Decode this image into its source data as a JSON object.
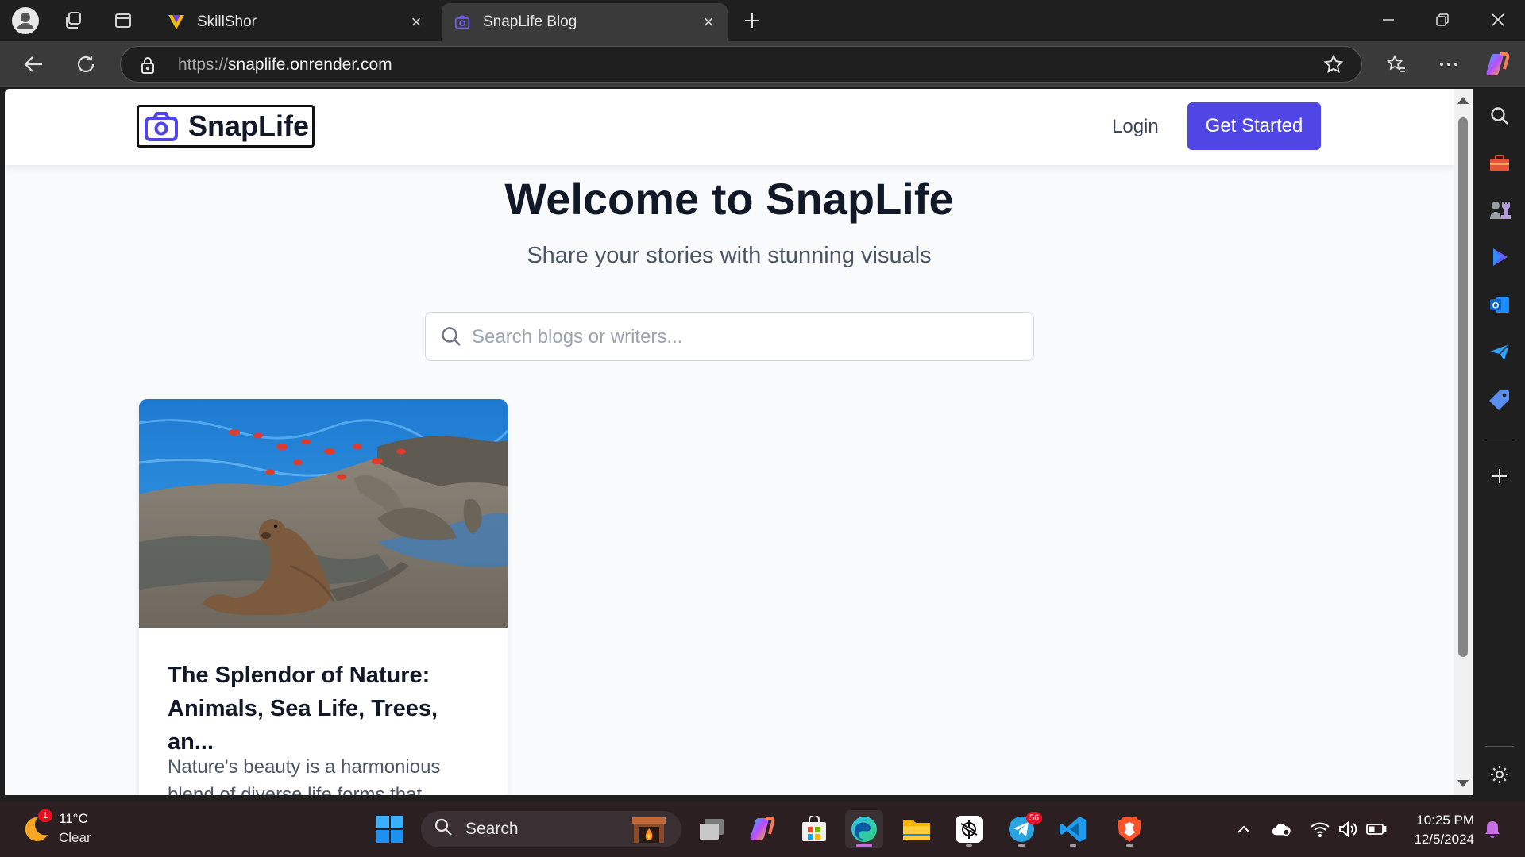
{
  "browser": {
    "tabs": [
      {
        "label": "SkillShor",
        "active": false
      },
      {
        "label": "SnapLife Blog",
        "active": true
      }
    ],
    "address": {
      "scheme": "https://",
      "host": "snaplife.onrender.com"
    }
  },
  "site": {
    "logo_text": "SnapLife",
    "nav": {
      "login": "Login",
      "cta": "Get Started"
    },
    "hero": {
      "title": "Welcome to SnapLife",
      "subtitle": "Share your stories with stunning visuals"
    },
    "search": {
      "placeholder": "Search blogs or writers..."
    },
    "posts": [
      {
        "title": "The Splendor of Nature: Animals, Sea Life, Trees, an...",
        "excerpt": "Nature's beauty is a harmonious blend of diverse life forms that"
      }
    ]
  },
  "taskbar": {
    "weather": {
      "temp": "11°C",
      "condition": "Clear",
      "badge": "1"
    },
    "search_label": "Search",
    "telegram_badge": "56",
    "time": "10:25 PM",
    "date": "12/5/2024"
  },
  "colors": {
    "accent": "#4f46e5",
    "taskbar": "#2b1f22",
    "browser_chrome": "#1f1f1f"
  }
}
